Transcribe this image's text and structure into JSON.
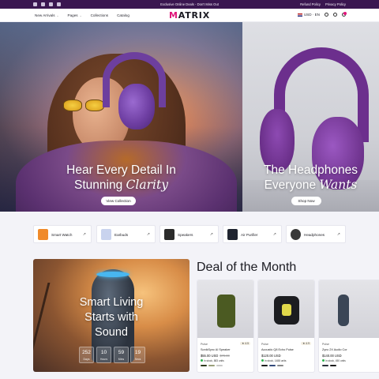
{
  "topbar": {
    "announcement": "Exclusive Online Deals - Don't Miss Out",
    "links": [
      "Refund Policy",
      "Privacy Policy"
    ],
    "socials": [
      "facebook-icon",
      "instagram-icon",
      "youtube-icon",
      "tiktok-icon"
    ]
  },
  "nav": {
    "menu": [
      {
        "label": "New Arrivals",
        "dropdown": true
      },
      {
        "label": "Pages",
        "dropdown": true
      },
      {
        "label": "Collections",
        "dropdown": false
      },
      {
        "label": "Catalog",
        "dropdown": false
      }
    ],
    "logo_accent": "M",
    "logo_rest": "ATRIX",
    "currency": "USD",
    "language": "EN"
  },
  "hero": {
    "left": {
      "line1": "Hear Every Detail In",
      "line2_plain": "Stunning",
      "line2_script": "Clarity",
      "button": "View Collection"
    },
    "right": {
      "line1": "The Headphones",
      "line2_plain": "Everyone",
      "line2_script": "Wants",
      "button": "Shop Now"
    }
  },
  "categories": [
    {
      "label": "Smart Watch",
      "color": "#f08a2a"
    },
    {
      "label": "Earbuds",
      "color": "#c9d3ee"
    },
    {
      "label": "Speakers",
      "color": "#2b2b2b"
    },
    {
      "label": "Air Purifier",
      "color": "#1f2430"
    },
    {
      "label": "Headphones",
      "color": "#3a3a3a"
    }
  ],
  "promo": {
    "line1": "Smart Living",
    "line2": "Starts with",
    "line3_script": "Sound",
    "countdown": [
      {
        "value": "252",
        "unit": "Days"
      },
      {
        "value": "10",
        "unit": "Hours"
      },
      {
        "value": "59",
        "unit": "Mins"
      },
      {
        "value": "19",
        "unit": "Secs"
      }
    ]
  },
  "deal": {
    "title": "Deal of the Month",
    "products": [
      {
        "brand": "Pulse",
        "rating": "4.5",
        "name": "SonikSync AI Speaker",
        "price": "$55.00 USD",
        "old_price": "$70.00",
        "stock": "In stock, 883 units",
        "swatches": [
          "#2e3a1e",
          "#9aa07a",
          "#c8c8c8"
        ],
        "product_color": "#4b5a22"
      },
      {
        "brand": "Pulse",
        "rating": "4.9",
        "name": "Acoustic Q8 Echo Pulse",
        "price": "$120.00 USD",
        "old_price": "",
        "stock": "In stock, 1488 units",
        "swatches": [
          "#1d1d1d",
          "#334a7a",
          "#8a8a8a"
        ],
        "product_color": "#1c1d20"
      },
      {
        "brand": "Pulse",
        "rating": "",
        "name": "Zync 2X Audio Cor",
        "price": "$140.00 USD",
        "old_price": "",
        "stock": "In stock, 450 units",
        "swatches": [
          "#2a2f3a",
          "#1d1d1d"
        ],
        "product_color": "#3b4656"
      }
    ]
  },
  "colors": {
    "accent": "#e0157a",
    "topbar": "#3a1650",
    "headphone_purple": "#6d3f9e"
  }
}
